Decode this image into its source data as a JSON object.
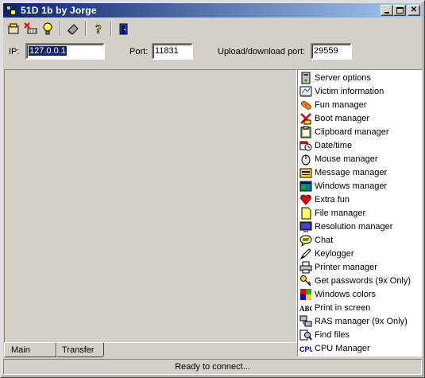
{
  "window": {
    "title": "51D 1b by Jorge"
  },
  "toolbar": {
    "icons": [
      "new-server-icon",
      "disconnect-icon",
      "lightbulb-icon",
      "eraser-icon",
      "help-icon",
      "exit-icon"
    ]
  },
  "connection": {
    "ip_label": "IP:",
    "ip_value": "127.0.0.1",
    "port_label": "Port:",
    "port_value": "11831",
    "transfer_label": "Upload/download port:",
    "transfer_value": "29559"
  },
  "tabs": [
    {
      "label": "Main",
      "active": true
    },
    {
      "label": "Transfer",
      "active": false
    }
  ],
  "menu": {
    "items": [
      {
        "label": "Server options",
        "icon": "server-icon"
      },
      {
        "label": "Victim information",
        "icon": "info-icon"
      },
      {
        "label": "Fun manager",
        "icon": "bandage-icon"
      },
      {
        "label": "Boot manager",
        "icon": "x-icon"
      },
      {
        "label": "Clipboard manager",
        "icon": "clipboard-icon"
      },
      {
        "label": "Date/time",
        "icon": "calendar-icon"
      },
      {
        "label": "Mouse manager",
        "icon": "mouse-icon"
      },
      {
        "label": "Message manager",
        "icon": "message-icon"
      },
      {
        "label": "Windows manager",
        "icon": "windows-icon"
      },
      {
        "label": "Extra fun",
        "icon": "heart-icon"
      },
      {
        "label": "File manager",
        "icon": "file-icon"
      },
      {
        "label": "Resolution manager",
        "icon": "monitor-icon"
      },
      {
        "label": "Chat",
        "icon": "chat-icon"
      },
      {
        "label": "Keylogger",
        "icon": "pencil-icon"
      },
      {
        "label": "Printer manager",
        "icon": "printer-icon"
      },
      {
        "label": "Get passwords (9x Only)",
        "icon": "key-icon"
      },
      {
        "label": "Windows colors",
        "icon": "colors-icon"
      },
      {
        "label": "Print in screen",
        "icon": "abc-icon"
      },
      {
        "label": "RAS manager (9x Only)",
        "icon": "network-icon"
      },
      {
        "label": "Find files",
        "icon": "find-icon"
      },
      {
        "label": "CPU Manager",
        "icon": "cpu-icon"
      }
    ]
  },
  "status": {
    "text": "Ready to connect..."
  }
}
